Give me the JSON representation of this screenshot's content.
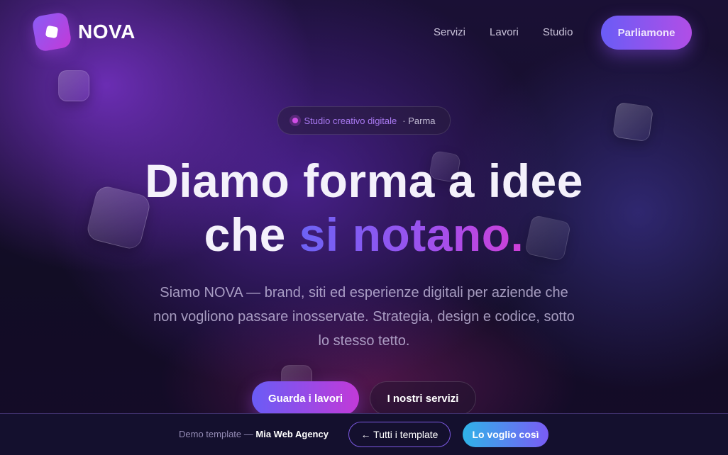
{
  "brand": {
    "name": "NOVA",
    "icon": "nova-logo-icon"
  },
  "nav": {
    "items": [
      {
        "label": "Servizi"
      },
      {
        "label": "Lavori"
      },
      {
        "label": "Studio"
      }
    ],
    "cta": "Parliamone"
  },
  "hero": {
    "badge_primary": "Studio creativo digitale",
    "badge_secondary": "· Parma",
    "headline_line1": "Diamo forma a idee",
    "headline_line2_plain": "che ",
    "headline_line2_accent": "si notano.",
    "subtitle": "Siamo NOVA — brand, siti ed esperienze digitali per aziende che non vogliono passare inosservate. Strategia, design e codice, sotto lo stesso tetto.",
    "primary_button": "Guarda i lavori",
    "secondary_button": "I nostri servizi"
  },
  "demo_bar": {
    "prefix": "Demo template — ",
    "agency": "Mia Web Agency",
    "back_button": "← Tutti i template",
    "cta_button": "Lo voglio così"
  },
  "colors": {
    "accent_start": "#6a5cf6",
    "accent_end": "#c23ad8",
    "bar_cta_start": "#2fb3e8",
    "background": "#120d25"
  }
}
